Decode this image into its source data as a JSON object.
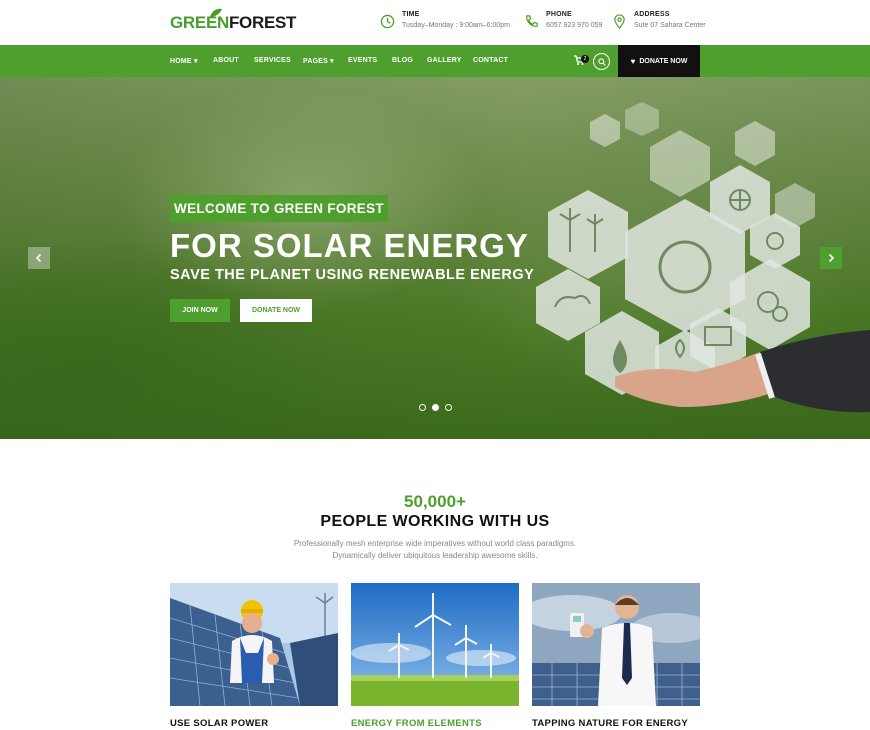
{
  "brand": {
    "part1": "GREEN",
    "part2": "FOREST",
    "accent": "#4e9f2d"
  },
  "contact": [
    {
      "icon": "clock-icon",
      "label": "TIME",
      "value": "Tusday–Monday : 9:00am–6:00pm"
    },
    {
      "icon": "phone-icon",
      "label": "PHONE",
      "value": "6057 923 970 059"
    },
    {
      "icon": "location-pin-icon",
      "label": "ADDRESS",
      "value": "Sute 07 Sahara Center"
    }
  ],
  "nav": {
    "items": [
      "HOME",
      "ABOUT",
      "SERVICES",
      "PAGES",
      "EVENTS",
      "BLOG",
      "GALLERY",
      "CONTACT"
    ],
    "cart_count": "2",
    "donate_label": "DONATE NOW"
  },
  "hero": {
    "badge": "WELCOME TO GREEN FOREST",
    "title": "FOR SOLAR ENERGY",
    "subtitle": "SAVE THE PLANET USING RENEWABLE ENERGY",
    "join_label": "JOIN NOW",
    "donate_label": "DONATE NOW",
    "slides": 3,
    "active_slide": 2
  },
  "section": {
    "stat": "50,000+",
    "heading": "PEOPLE WORKING WITH US",
    "desc_line1": "Professionally mesh enterprise wide imperatives without world class paradigms.",
    "desc_line2": "Dynamically deliver ubiquitous leadership awesome skills."
  },
  "cards": [
    {
      "title": "USE SOLAR POWER",
      "color": "#111111"
    },
    {
      "title": "ENERGY FROM ELEMENTS",
      "color": "#4e9f2d"
    },
    {
      "title": "TAPPING NATURE FOR ENERGY",
      "color": "#111111"
    }
  ]
}
